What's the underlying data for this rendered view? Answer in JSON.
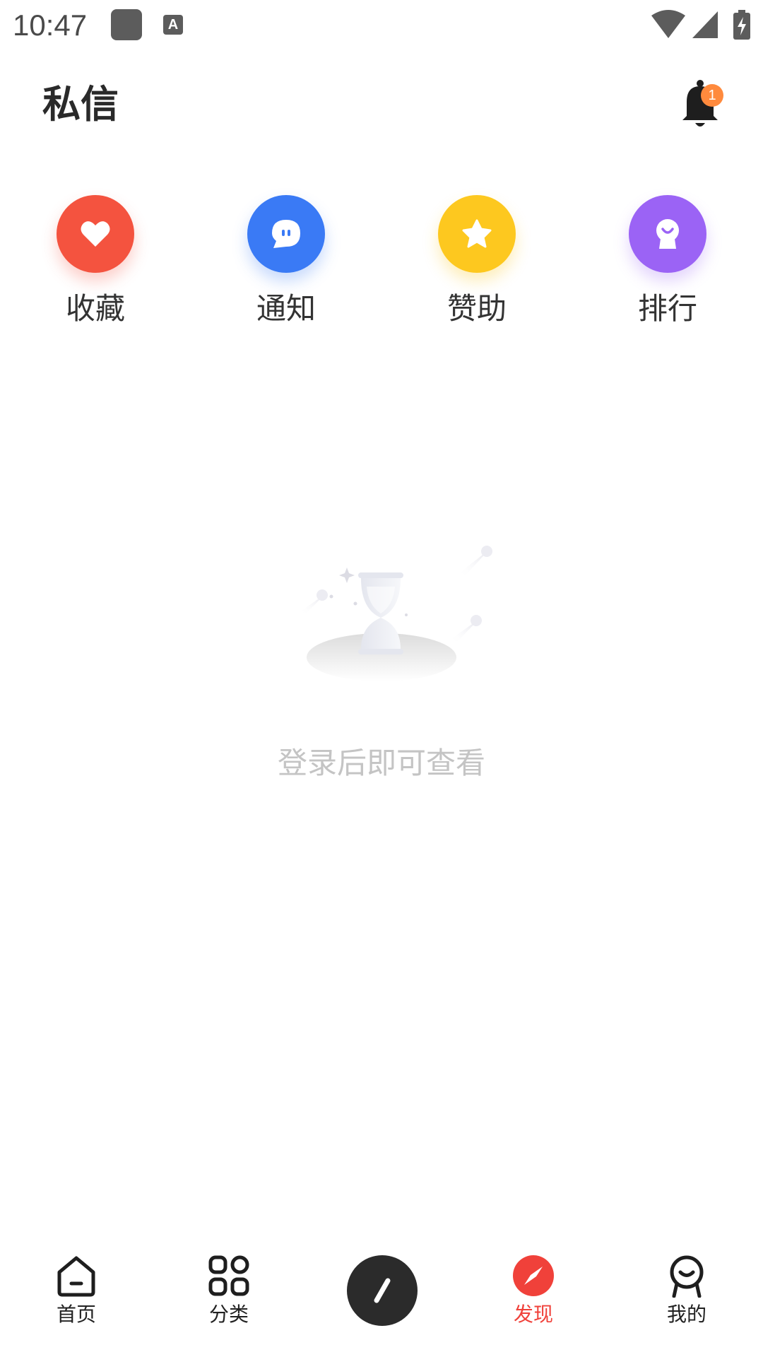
{
  "status_bar": {
    "time": "10:47",
    "a_glyph": "A",
    "icons": [
      "app-square-icon",
      "keyboard-a-icon",
      "wifi-icon",
      "signal-icon",
      "battery-charging-icon"
    ]
  },
  "header": {
    "title": "私信",
    "bell_icon": "bell-icon",
    "badge_count": "1"
  },
  "quick_actions": [
    {
      "label": "收藏",
      "icon": "heart-icon",
      "color": "#f4533f"
    },
    {
      "label": "通知",
      "icon": "chat-bubble-icon",
      "color": "#3a7af5"
    },
    {
      "label": "赞助",
      "icon": "star-icon",
      "color": "#fdc81f"
    },
    {
      "label": "排行",
      "icon": "rank-badge-icon",
      "color": "#9b63f5"
    }
  ],
  "empty_state": {
    "message": "登录后即可查看",
    "illustration": "hourglass-illustration"
  },
  "bottom_nav": {
    "items": [
      {
        "label": "首页",
        "icon": "home-icon",
        "active": false
      },
      {
        "label": "分类",
        "icon": "grid-icon",
        "active": false
      },
      {
        "label": "",
        "icon": "pen-icon",
        "active": false
      },
      {
        "label": "发现",
        "icon": "compass-icon",
        "active": true
      },
      {
        "label": "我的",
        "icon": "profile-icon",
        "active": false
      }
    ],
    "active_color": "#f0413a"
  }
}
